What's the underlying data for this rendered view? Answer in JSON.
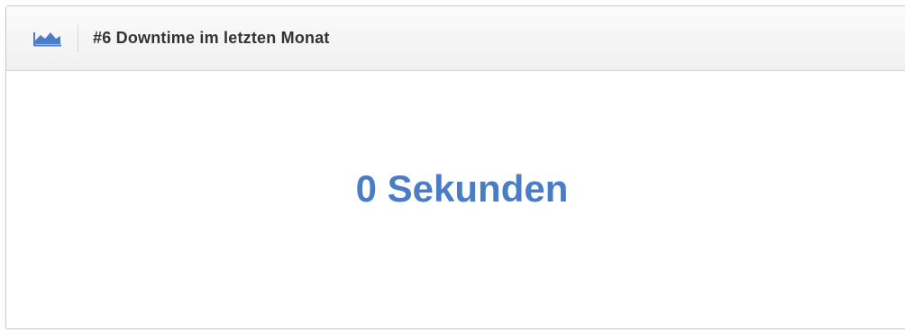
{
  "widget": {
    "icon": "area-chart-icon",
    "title": "#6 Downtime im letzten Monat",
    "value": "0 Sekunden",
    "accent_color": "#4a7dc6"
  }
}
